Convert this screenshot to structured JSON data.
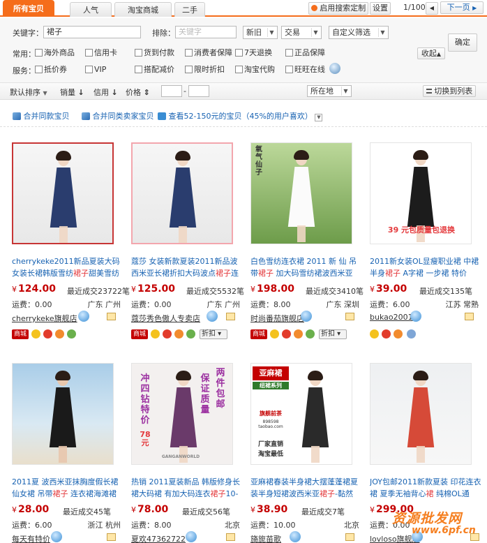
{
  "tabs": [
    "所有宝贝",
    "人气",
    "淘宝商城",
    "二手"
  ],
  "toolbar": {
    "custom_search": "启用搜索定制",
    "settings": "设置",
    "page_info": "1/100",
    "next_page": "下一页"
  },
  "filter": {
    "keyword_label": "关键字：",
    "keyword_value": "裙子",
    "exclude_label": "排除：",
    "exclude_placeholder": "关键字",
    "select_new": "新旧",
    "select_trade": "交易",
    "select_custom": "自定义筛选",
    "confirm": "确定",
    "collapse": "收起",
    "common_label": "常用：",
    "common_options": [
      "海外商品",
      "信用卡",
      "货到付款",
      "消费者保障",
      "7天退换",
      "正品保障"
    ],
    "service_label": "服务：",
    "service_options": [
      "抵价券",
      "VIP",
      "搭配减价",
      "限时折扣",
      "淘宝代购",
      "旺旺在线"
    ]
  },
  "sort": {
    "default": "默认排序",
    "sales": "销量",
    "credit": "信用",
    "price": "价格",
    "dash": "-",
    "location": "所在地",
    "switch_list": "切换到列表"
  },
  "tips": [
    "合并同款宝贝",
    "合并同类卖家宝贝",
    "查看52-150元的宝贝（45%的用户喜欢）"
  ],
  "items": [
    {
      "title_before": "cherrykeke2011新品夏装大码女装长裙韩版雪纺",
      "title_hl": "裙子",
      "title_after": "甜美雪纺",
      "price": "124.00",
      "sold": "最近成交23722笔",
      "shipping": "运费：0.00",
      "location": "广东 广州",
      "shop": "cherrykeke旗舰店",
      "badges": [
        "商城"
      ]
    },
    {
      "title_before": "蔻莎 女装新款夏装2011新品波西米亚长裙折扣大码波点",
      "title_hl": "裙子",
      "title_after": "连",
      "price": "125.00",
      "sold": "最近成交5532笔",
      "shipping": "运费：0.00",
      "location": "广东 广州",
      "shop": "蔻莎秀色傲人专卖店",
      "badges": [
        "商城",
        "折扣"
      ]
    },
    {
      "title_before": "白色雪纺连衣裙 2011 新 仙 吊带",
      "title_hl": "裙子",
      "title_after": " 加大码雪纺裙波西米亚",
      "price": "198.00",
      "sold": "最近成交3410笔",
      "shipping": "运费：8.00",
      "location": "广东 深圳",
      "shop": "时尚番茄旗舰店",
      "badges": [
        "商城",
        "折扣"
      ]
    },
    {
      "title_before": "2011新女装OL显瘦职业裙 中裙半身",
      "title_hl": "裙子",
      "title_after": " A字裙 一步裙 特价",
      "price": "39.00",
      "sold": "最近成交135笔",
      "shipping": "运费：6.00",
      "location": "江苏 常熟",
      "shop": "bukao2001",
      "badges": []
    },
    {
      "title_before": "2011夏 波西米亚抹胸度假长裙仙女裙 吊带",
      "title_hl": "裙子",
      "title_after": " 连衣裙海滩裙",
      "price": "28.00",
      "sold": "最近成交45笔",
      "shipping": "运费：6.00",
      "location": "浙江 杭州",
      "shop": "每天有特价",
      "badges": []
    },
    {
      "title_before": "热销 2011夏装新品 韩版修身长裙大码裙 有加大码连衣",
      "title_hl": "裙子",
      "title_after": "10-",
      "price": "78.00",
      "sold": "最近成交56笔",
      "shipping": "运费：8.00",
      "location": "北京",
      "shop": "夏欢47362722",
      "badges": []
    },
    {
      "title_before": "亚麻裙春装半身裙大摆蓬蓬裙夏装半身短裙波西米亚",
      "title_hl": "裙子",
      "title_after": "-黏然",
      "price": "38.90",
      "sold": "最近成交7笔",
      "shipping": "运费：10.00",
      "location": "北京",
      "shop": "旖旎苗歌",
      "badges": []
    },
    {
      "title_before": "JOY包邮2011新款夏装 印花连衣裙 夏季无袖背心",
      "title_hl": "裙",
      "title_after": " 纯棉OL通",
      "price": "299.00",
      "sold": "",
      "shipping": "运费：0.00",
      "location": "",
      "shop": "lovloso旗舰店",
      "badges": []
    }
  ],
  "promo_texts": {
    "p4": "39 元包质量包退换",
    "p6a": "冲四钻特价",
    "p6b": "78元",
    "p6c": "两件包邮",
    "p6d": "保证质量",
    "p6e": "GANGANWORLD",
    "p3": "氧气仙子",
    "p7a": "亚麻裙",
    "p7b": "纽裙系列",
    "p7c": "旗舰前茶",
    "p7d": "898598 taobao.com",
    "p7e": "厂家直销",
    "p7f": "淘宝最低"
  },
  "watermark": {
    "text1": "资源批发网",
    "text2": "www.6pf.cn"
  }
}
